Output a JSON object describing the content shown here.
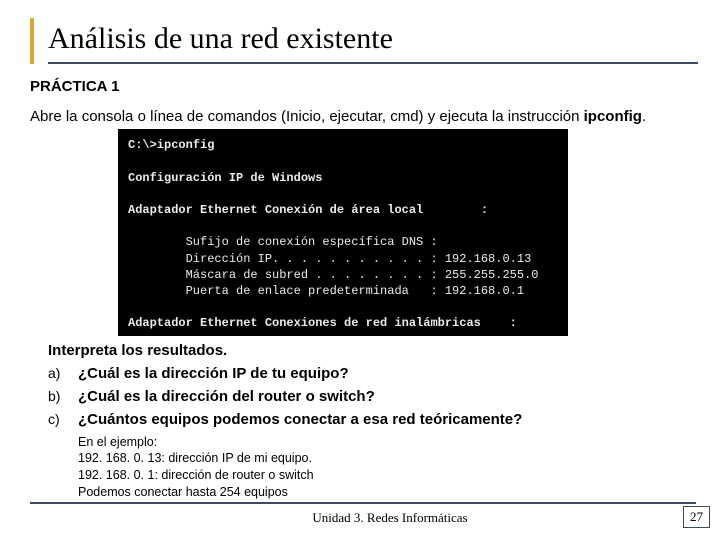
{
  "title": "Análisis de una red existente",
  "practica_label": "PRÁCTICA 1",
  "intro_1": "Abre la consola o línea de comandos (Inicio, ejecutar, cmd)  y ejecuta la instrucción ",
  "intro_cmd": "ipconfig",
  "intro_2": ".",
  "console": {
    "prompt": "C:\\>ipconfig",
    "header": "Configuración IP de Windows",
    "adapter1": "Adaptador Ethernet Conexión de área local        :",
    "dns": "        Sufijo de conexión específica DNS :",
    "ip": "        Dirección IP. . . . . . . . . . . : 192.168.0.13",
    "mask": "        Máscara de subred . . . . . . . . : 255.255.255.0",
    "gw": "        Puerta de enlace predeterminada   : 192.168.0.1",
    "adapter2": "Adaptador Ethernet Conexiones de red inalámbricas    :"
  },
  "interpret": "Interpreta los resultados.",
  "questions": {
    "a": {
      "label": "a)",
      "text": "¿Cuál es la dirección IP de tu equipo?"
    },
    "b": {
      "label": "b)",
      "text": "¿Cuál es la dirección del router o switch?"
    },
    "c": {
      "label": "c)",
      "text": "¿Cuántos equipos podemos conectar a esa red teóricamente?"
    }
  },
  "example": {
    "l1": "En el ejemplo:",
    "l2": "192. 168. 0. 13: dirección IP de mi equipo.",
    "l3": "192. 168. 0. 1:   dirección de router o switch",
    "l4": "Podemos conectar hasta 254 equipos"
  },
  "footer": "Unidad 3. Redes Informáticas",
  "page": "27"
}
